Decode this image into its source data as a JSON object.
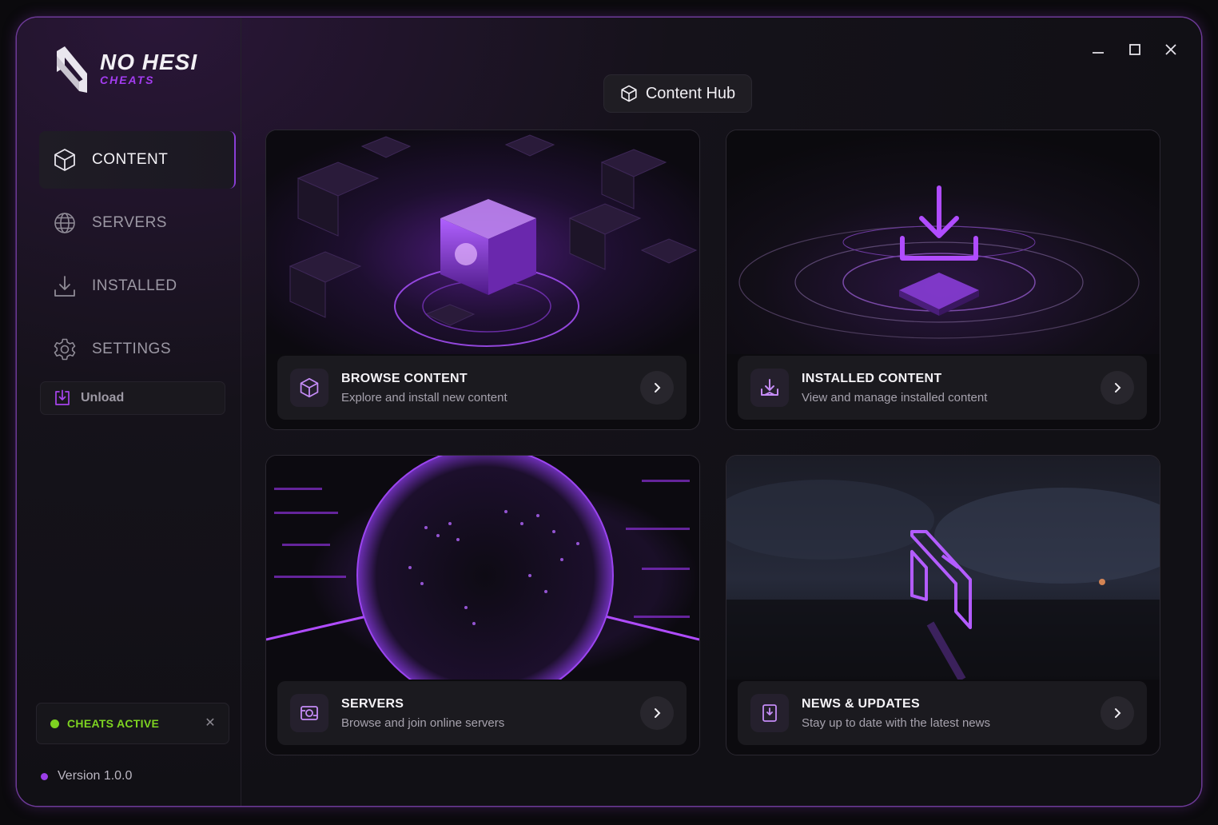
{
  "brand": {
    "title": "NO HESI",
    "subtitle": "CHEATS",
    "accent": "#9b3ee8"
  },
  "window_controls": {
    "minimize": "minimize-icon",
    "maximize": "maximize-icon",
    "close": "close-icon"
  },
  "header": {
    "hub_label": "Content Hub",
    "hub_icon": "cube-icon"
  },
  "sidebar": {
    "items": [
      {
        "label": "CONTENT",
        "icon": "cube-icon",
        "active": true
      },
      {
        "label": "SERVERS",
        "icon": "globe-icon",
        "active": false
      },
      {
        "label": "INSTALLED",
        "icon": "download-icon",
        "active": false
      },
      {
        "label": "SETTINGS",
        "icon": "gear-icon",
        "active": false
      }
    ],
    "unload_label": "Unload",
    "status_label": "CHEATS ACTIVE",
    "status_color": "#7ed321",
    "version_label": "Version 1.0.0"
  },
  "cards": [
    {
      "title": "BROWSE CONTENT",
      "desc": "Explore and install new content",
      "icon": "cube-icon"
    },
    {
      "title": "INSTALLED CONTENT",
      "desc": "View and manage installed content",
      "icon": "download-tray-icon"
    },
    {
      "title": "SERVERS",
      "desc": "Browse and join online servers",
      "icon": "server-icon"
    },
    {
      "title": "NEWS & UPDATES",
      "desc": "Stay up to date with the latest news",
      "icon": "news-icon"
    }
  ]
}
